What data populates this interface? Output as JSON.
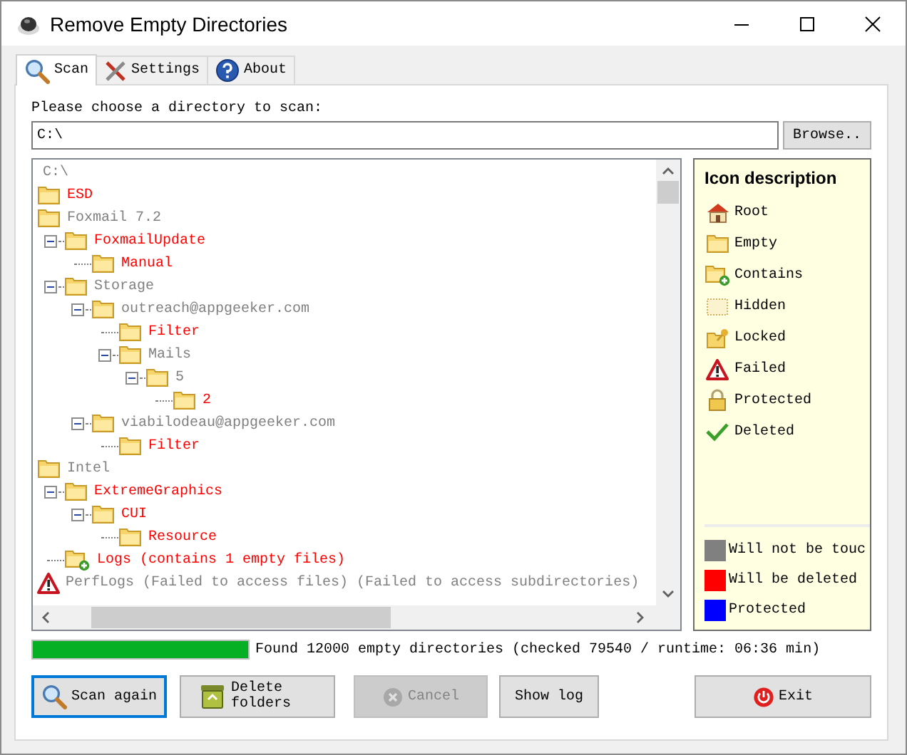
{
  "window": {
    "title": "Remove Empty Directories"
  },
  "tabs": [
    {
      "label": "Scan",
      "selected": true
    },
    {
      "label": "Settings",
      "selected": false
    },
    {
      "label": "About",
      "selected": false
    }
  ],
  "directory": {
    "label": "Please choose a directory to scan:",
    "value": "C:\\",
    "browse": "Browse.."
  },
  "tree": {
    "root": "C:\\",
    "children": [
      {
        "label": "ESD",
        "kind": "empty"
      },
      {
        "label": "Foxmail 7.2",
        "kind": "kept",
        "children": [
          {
            "label": "FoxmailUpdate",
            "kind": "empty",
            "expanded": true,
            "children": [
              {
                "label": "Manual",
                "kind": "empty"
              }
            ]
          },
          {
            "label": "Storage",
            "kind": "kept",
            "expanded": true,
            "children": [
              {
                "label": "outreach@appgeeker.com",
                "kind": "kept",
                "expanded": true,
                "children": [
                  {
                    "label": "Filter",
                    "kind": "empty"
                  },
                  {
                    "label": "Mails",
                    "kind": "kept",
                    "expanded": true,
                    "children": [
                      {
                        "label": "5",
                        "kind": "kept",
                        "expanded": true,
                        "children": [
                          {
                            "label": "2",
                            "kind": "empty"
                          }
                        ]
                      }
                    ]
                  }
                ]
              },
              {
                "label": "viabilodeau@appgeeker.com",
                "kind": "kept",
                "expanded": true,
                "children": [
                  {
                    "label": "Filter",
                    "kind": "empty"
                  }
                ]
              }
            ]
          }
        ]
      },
      {
        "label": "Intel",
        "kind": "kept",
        "children": [
          {
            "label": "ExtremeGraphics",
            "kind": "empty",
            "expanded": true,
            "children": [
              {
                "label": "CUI",
                "kind": "empty",
                "expanded": true,
                "children": [
                  {
                    "label": "Resource",
                    "kind": "empty"
                  }
                ]
              }
            ]
          },
          {
            "label": "Logs (contains 1 empty files)",
            "kind": "contains"
          }
        ]
      },
      {
        "label": "PerfLogs (Failed to access files) (Failed to access subdirectories)",
        "kind": "failed"
      }
    ]
  },
  "legend": {
    "title": "Icon description",
    "icons": [
      {
        "kind": "root",
        "label": "Root"
      },
      {
        "kind": "empty",
        "label": "Empty"
      },
      {
        "kind": "contains",
        "label": "Contains"
      },
      {
        "kind": "hidden",
        "label": "Hidden"
      },
      {
        "kind": "locked",
        "label": "Locked"
      },
      {
        "kind": "failed",
        "label": "Failed"
      },
      {
        "kind": "protected",
        "label": "Protected"
      },
      {
        "kind": "deleted",
        "label": "Deleted"
      }
    ],
    "colors": [
      {
        "label": "Will not be touc",
        "color": "#808080"
      },
      {
        "label": "Will be deleted",
        "color": "#ff0000"
      },
      {
        "label": "Protected",
        "color": "#0000ff"
      }
    ]
  },
  "progress": {
    "level": 1,
    "text": "Found 12000 empty directories (checked 79540 / runtime: 06:36 min)"
  },
  "buttons": [
    {
      "label": "Scan again",
      "focused": true,
      "disabled": false
    },
    {
      "label": "Delete folders",
      "focused": false,
      "disabled": false
    },
    {
      "label": "Cancel",
      "focused": false,
      "disabled": true
    },
    {
      "label": "Show log",
      "focused": false,
      "disabled": false
    },
    {
      "label": "Exit",
      "focused": false,
      "disabled": false
    }
  ]
}
